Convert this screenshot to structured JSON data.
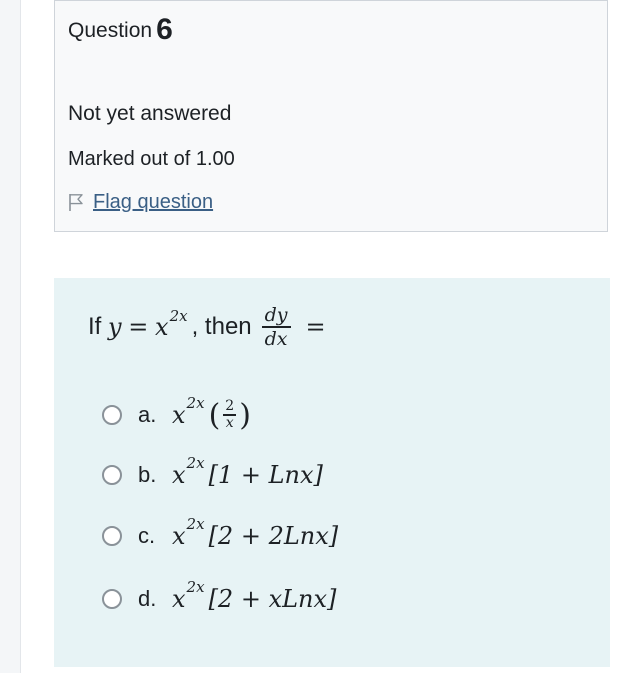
{
  "question": {
    "label": "Question",
    "number": "6",
    "state": "Not yet answered",
    "grade": "Marked out of 1.00",
    "flag_label": "Flag question"
  },
  "content": {
    "prefix": "If",
    "lhs": "y",
    "equals": "=",
    "base": "x",
    "exponent": "2x",
    "mid": ", then",
    "deriv_num": "dy",
    "deriv_den": "dx",
    "tail_equals": "="
  },
  "options": [
    {
      "letter": "a.",
      "base": "x",
      "exponent": "2x",
      "frac_num": "2",
      "frac_den": "x",
      "open": "(",
      "close": ")"
    },
    {
      "letter": "b.",
      "base": "x",
      "exponent": "2x",
      "expr": "[1 + Lnx]"
    },
    {
      "letter": "c.",
      "base": "x",
      "exponent": "2x",
      "expr": "[2 + 2Lnx]"
    },
    {
      "letter": "d.",
      "base": "x",
      "exponent": "2x",
      "expr": "[2 + xLnx]"
    }
  ],
  "colors": {
    "content_bg": "#e7f3f5",
    "info_bg": "#f8f9fa",
    "link": "#3a5f85"
  }
}
